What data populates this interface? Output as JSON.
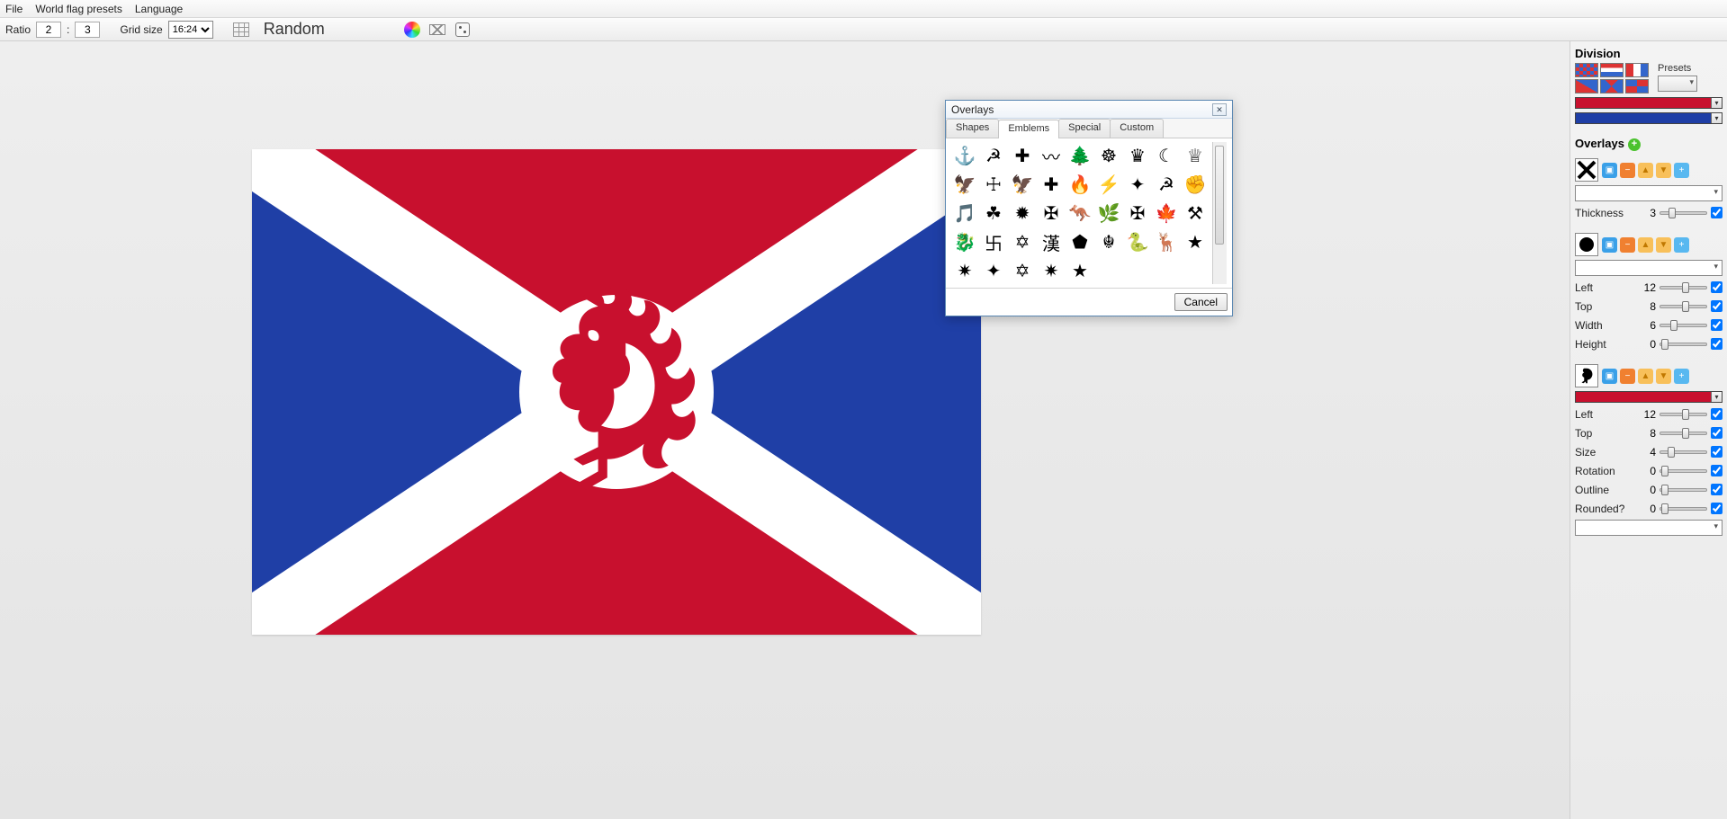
{
  "menu": {
    "file": "File",
    "presets": "World flag presets",
    "language": "Language"
  },
  "toolbar": {
    "ratio_label": "Ratio",
    "ratio_a": "2",
    "ratio_sep": ":",
    "ratio_b": "3",
    "gridsize_label": "Grid size",
    "gridsize_value": "16:24",
    "random": "Random"
  },
  "dialog": {
    "title": "Overlays",
    "tabs": {
      "shapes": "Shapes",
      "emblems": "Emblems",
      "special": "Special",
      "custom": "Custom"
    },
    "active_tab": "Emblems",
    "cancel": "Cancel",
    "emblems": [
      "⚓",
      "☭",
      "✚",
      "〰",
      "🌲",
      "☸",
      "♛",
      "☾",
      "♕",
      "🦅",
      "☩",
      "🦅",
      "✚",
      "🔥",
      "⚡",
      "✦",
      "☭",
      "✊",
      "🎵",
      "☘",
      "✹",
      "✠",
      "🦘",
      "🌿",
      "✠",
      "🍁",
      "⚒",
      "🐉",
      "卐",
      "✡",
      "漢",
      "⬟",
      "☬",
      "🐍",
      "🦌",
      "★",
      "✷",
      "✦",
      "✡",
      "✷",
      "★"
    ]
  },
  "panel": {
    "division": "Division",
    "presets_label": "Presets",
    "colors": {
      "c1": "#c8102e",
      "c2": "#1e3a8a"
    },
    "overlays_title": "Overlays",
    "thickness_label": "Thickness",
    "ovl1": {
      "thickness": "3"
    },
    "ovl2": {
      "left_label": "Left",
      "left": "12",
      "top_label": "Top",
      "top": "8",
      "width_label": "Width",
      "width": "6",
      "height_label": "Height",
      "height": "0"
    },
    "ovl3": {
      "color": "#c8102e",
      "left_label": "Left",
      "left": "12",
      "top_label": "Top",
      "top": "8",
      "size_label": "Size",
      "size": "4",
      "rotation_label": "Rotation",
      "rotation": "0",
      "outline_label": "Outline",
      "outline": "0",
      "rounded_label": "Rounded?",
      "rounded": "0"
    }
  }
}
